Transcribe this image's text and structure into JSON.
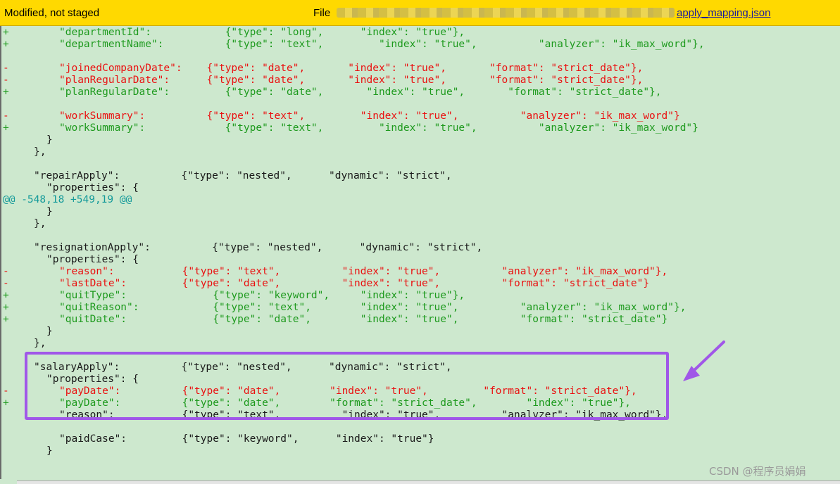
{
  "header": {
    "status": "Modified, not staged",
    "file_label": "File",
    "file_name_visible": "apply_mapping.json"
  },
  "lines": [
    {
      "marker": "+",
      "kind": "add",
      "indent": 84,
      "text": "\"departmentId\":            {\"type\": \"long\",      \"index\": \"true\"},"
    },
    {
      "marker": "+",
      "kind": "add",
      "indent": 84,
      "text": "\"departmentName\":          {\"type\": \"text\",         \"index\": \"true\",          \"analyzer\": \"ik_max_word\"},"
    },
    {
      "marker": "",
      "kind": "ctx",
      "indent": 84,
      "text": ""
    },
    {
      "marker": "-",
      "kind": "del",
      "indent": 84,
      "text": "\"joinedCompanyDate\":    {\"type\": \"date\",       \"index\": \"true\",       \"format\": \"strict_date\"},"
    },
    {
      "marker": "-",
      "kind": "del",
      "indent": 84,
      "text": "\"planRegularDate\":      {\"type\": \"date\",       \"index\": \"true\",       \"format\": \"strict_date\"},"
    },
    {
      "marker": "+",
      "kind": "add",
      "indent": 84,
      "text": "\"planRegularDate\":         {\"type\": \"date\",       \"index\": \"true\",       \"format\": \"strict_date\"},"
    },
    {
      "marker": "",
      "kind": "ctx",
      "indent": 84,
      "text": ""
    },
    {
      "marker": "-",
      "kind": "del",
      "indent": 84,
      "text": "\"workSummary\":          {\"type\": \"text\",         \"index\": \"true\",          \"analyzer\": \"ik_max_word\"}"
    },
    {
      "marker": "+",
      "kind": "add",
      "indent": 84,
      "text": "\"workSummary\":             {\"type\": \"text\",         \"index\": \"true\",          \"analyzer\": \"ik_max_word\"}"
    },
    {
      "marker": "",
      "kind": "ctx",
      "indent": 66,
      "text": "}"
    },
    {
      "marker": "",
      "kind": "ctx",
      "indent": 48,
      "text": "},"
    },
    {
      "marker": "",
      "kind": "ctx",
      "indent": 48,
      "text": ""
    },
    {
      "marker": "",
      "kind": "ctx",
      "indent": 48,
      "text": "\"repairApply\":          {\"type\": \"nested\",      \"dynamic\": \"strict\","
    },
    {
      "marker": "",
      "kind": "ctx",
      "indent": 66,
      "text": "\"properties\": {"
    },
    {
      "marker": "",
      "kind": "hunk",
      "indent": 4,
      "text": "@@ -548,18 +549,19 @@"
    },
    {
      "marker": "",
      "kind": "ctx",
      "indent": 66,
      "text": "}"
    },
    {
      "marker": "",
      "kind": "ctx",
      "indent": 48,
      "text": "},"
    },
    {
      "marker": "",
      "kind": "ctx",
      "indent": 48,
      "text": ""
    },
    {
      "marker": "",
      "kind": "ctx",
      "indent": 48,
      "text": "\"resignationApply\":          {\"type\": \"nested\",      \"dynamic\": \"strict\","
    },
    {
      "marker": "",
      "kind": "ctx",
      "indent": 66,
      "text": "\"properties\": {"
    },
    {
      "marker": "-",
      "kind": "del",
      "indent": 84,
      "text": "\"reason\":           {\"type\": \"text\",          \"index\": \"true\",          \"analyzer\": \"ik_max_word\"},"
    },
    {
      "marker": "-",
      "kind": "del",
      "indent": 84,
      "text": "\"lastDate\":         {\"type\": \"date\",          \"index\": \"true\",          \"format\": \"strict_date\"}"
    },
    {
      "marker": "+",
      "kind": "add",
      "indent": 84,
      "text": "\"quitType\":              {\"type\": \"keyword\",     \"index\": \"true\"},"
    },
    {
      "marker": "+",
      "kind": "add",
      "indent": 84,
      "text": "\"quitReason\":            {\"type\": \"text\",        \"index\": \"true\",          \"analyzer\": \"ik_max_word\"},"
    },
    {
      "marker": "+",
      "kind": "add",
      "indent": 84,
      "text": "\"quitDate\":              {\"type\": \"date\",        \"index\": \"true\",          \"format\": \"strict_date\"}"
    },
    {
      "marker": "",
      "kind": "ctx",
      "indent": 66,
      "text": "}"
    },
    {
      "marker": "",
      "kind": "ctx",
      "indent": 48,
      "text": "},"
    },
    {
      "marker": "",
      "kind": "ctx",
      "indent": 48,
      "text": ""
    },
    {
      "marker": "",
      "kind": "ctx",
      "indent": 48,
      "text": "\"salaryApply\":          {\"type\": \"nested\",      \"dynamic\": \"strict\","
    },
    {
      "marker": "",
      "kind": "ctx",
      "indent": 66,
      "text": "\"properties\": {"
    },
    {
      "marker": "-",
      "kind": "del",
      "indent": 84,
      "text": "\"payDate\":          {\"type\": \"date\",        \"index\": \"true\",         \"format\": \"strict_date\"},"
    },
    {
      "marker": "+",
      "kind": "add",
      "indent": 84,
      "text": "\"payDate\":          {\"type\": \"date\",        \"format\": \"strict_date\",        \"index\": \"true\"},"
    },
    {
      "marker": "",
      "kind": "ctx",
      "indent": 84,
      "text": "\"reason\":           {\"type\": \"text\",          \"index\": \"true\",          \"analyzer\": \"ik_max_word\"},"
    },
    {
      "marker": "",
      "kind": "ctx",
      "indent": 84,
      "text": ""
    },
    {
      "marker": "",
      "kind": "ctx",
      "indent": 84,
      "text": "\"paidCase\":         {\"type\": \"keyword\",      \"index\": \"true\"}"
    },
    {
      "marker": "",
      "kind": "ctx",
      "indent": 66,
      "text": "}"
    }
  ],
  "annotation": {
    "color": "#a057e8"
  },
  "colors": {
    "added": "#1e9a1e",
    "removed": "#ea1111",
    "context": "#1a1a1a",
    "hunk": "#149a9a",
    "header": "#ffd900",
    "background": "#cde8ce"
  },
  "watermark": "CSDN @程序员娟娟"
}
